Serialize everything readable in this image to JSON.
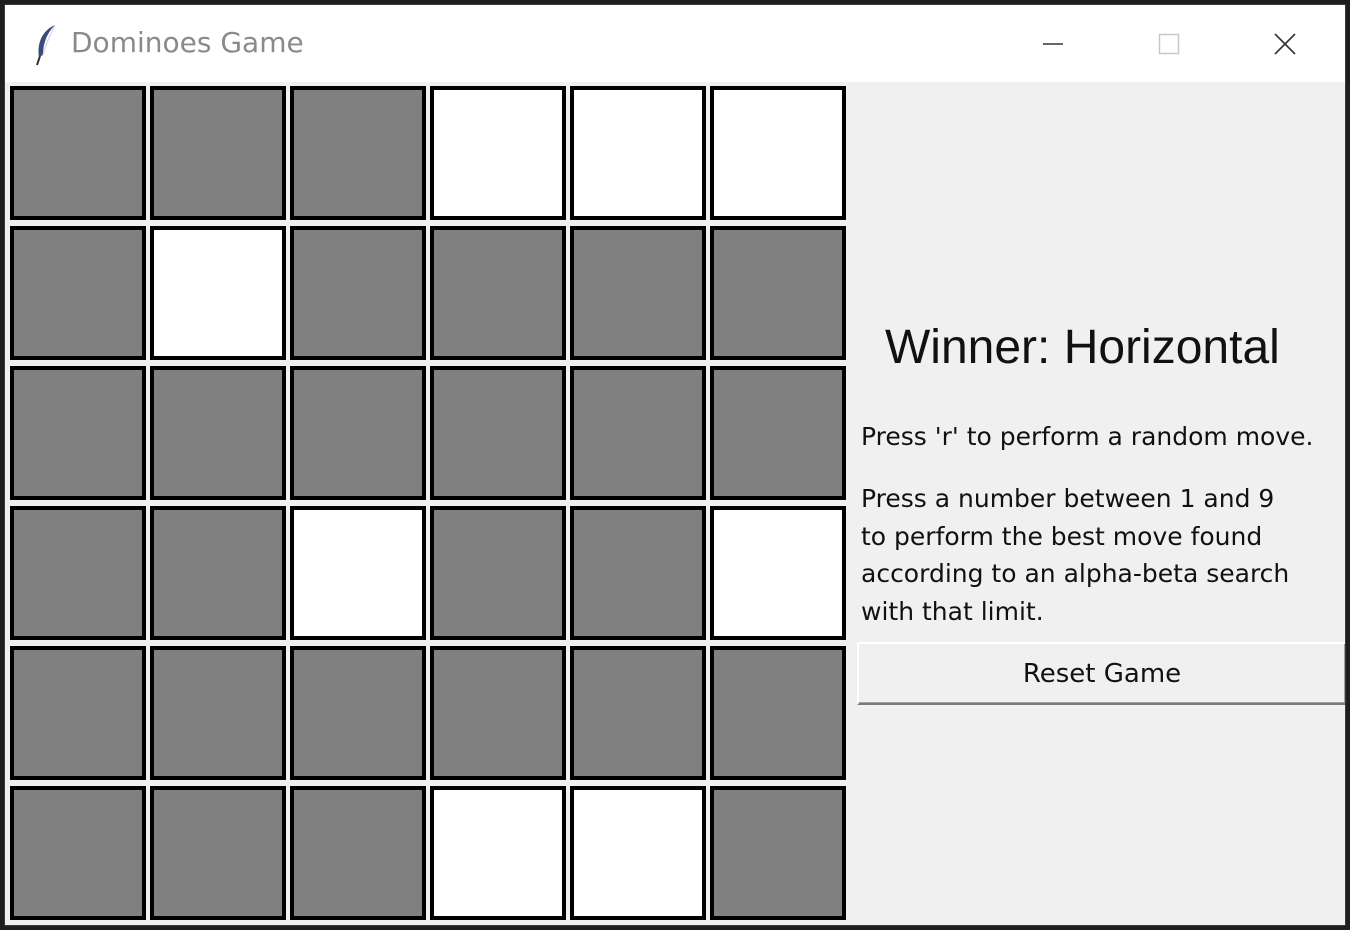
{
  "window": {
    "title": "Dominoes Game"
  },
  "board": {
    "rows": 6,
    "cols": 6,
    "filled_color": "#808080",
    "empty_color": "#ffffff",
    "cells": [
      [
        "filled",
        "filled",
        "filled",
        "empty",
        "empty",
        "empty"
      ],
      [
        "filled",
        "empty",
        "filled",
        "filled",
        "filled",
        "filled"
      ],
      [
        "filled",
        "filled",
        "filled",
        "filled",
        "filled",
        "filled"
      ],
      [
        "filled",
        "filled",
        "empty",
        "filled",
        "filled",
        "empty"
      ],
      [
        "filled",
        "filled",
        "filled",
        "filled",
        "filled",
        "filled"
      ],
      [
        "filled",
        "filled",
        "filled",
        "empty",
        "empty",
        "filled"
      ]
    ]
  },
  "status": {
    "winner_text": "Winner: Horizontal"
  },
  "instructions": {
    "random_move": "Press 'r' to perform a random move.",
    "best_move": "Press a number between 1 and 9\nto perform the best move found\naccording to an alpha-beta search\nwith that limit."
  },
  "controls": {
    "reset_label": "Reset Game"
  },
  "icons": {
    "app": "feather-icon",
    "minimize": "minimize-icon",
    "maximize": "maximize-icon",
    "close": "close-icon"
  }
}
